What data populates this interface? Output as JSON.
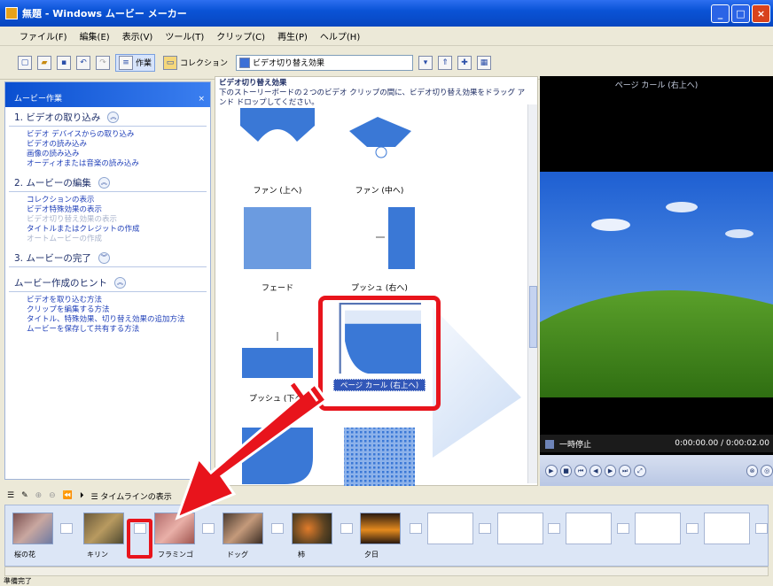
{
  "window": {
    "title": "無題 - Windows ムービー メーカー"
  },
  "menu": [
    "ファイル(F)",
    "編集(E)",
    "表示(V)",
    "ツール(T)",
    "クリップ(C)",
    "再生(P)",
    "ヘルプ(H)"
  ],
  "toolbar": {
    "tasks_label": "作業",
    "collections_label": "コレクション",
    "combo_value": "ビデオ切り替え効果"
  },
  "taskpane": {
    "title": "ムービー作業",
    "sections": [
      {
        "title": "1. ビデオの取り込み",
        "links": [
          "ビデオ デバイスからの取り込み",
          "ビデオの読み込み",
          "画像の読み込み",
          "オーディオまたは音楽の読み込み"
        ]
      },
      {
        "title": "2. ムービーの編集",
        "links": [
          "コレクションの表示",
          "ビデオ特殊効果の表示",
          "ビデオ切り替え効果の表示",
          "タイトルまたはクレジットの作成",
          "オートムービーの作成"
        ]
      },
      {
        "title": "3. ムービーの完了",
        "links": []
      },
      {
        "title": "ムービー作成のヒント",
        "links": [
          "ビデオを取り込む方法",
          "クリップを編集する方法",
          "タイトル、特殊効果、切り替え効果の追加方法",
          "ムービーを保存して共有する方法"
        ]
      }
    ]
  },
  "content": {
    "title": "ビデオ切り替え効果",
    "description": "下のストーリーボードの２つのビデオ クリップの間に、ビデオ切り替え効果をドラッグ アンド ドロップしてください。",
    "items": [
      "ファン (上へ)",
      "ファン (中へ)",
      "フェード",
      "プッシュ (右へ)",
      "プッシュ (下へ)",
      "ページ カール (右上へ)",
      "",
      ""
    ]
  },
  "monitor": {
    "title": "ページ カール (右上へ)",
    "status": "一時停止",
    "time": "0:00:00.00 / 0:00:02.00"
  },
  "storyboard": {
    "toolbar_label": "タイムラインの表示",
    "clips": [
      "桜の花",
      "キリン",
      "フラミンゴ",
      "ドッグ",
      "柿",
      "夕日"
    ]
  },
  "statusbar": "準備完了",
  "colors": {
    "titlebar": "#0a53d6",
    "highlight": "#e8141c",
    "link": "#1f3fb8"
  }
}
